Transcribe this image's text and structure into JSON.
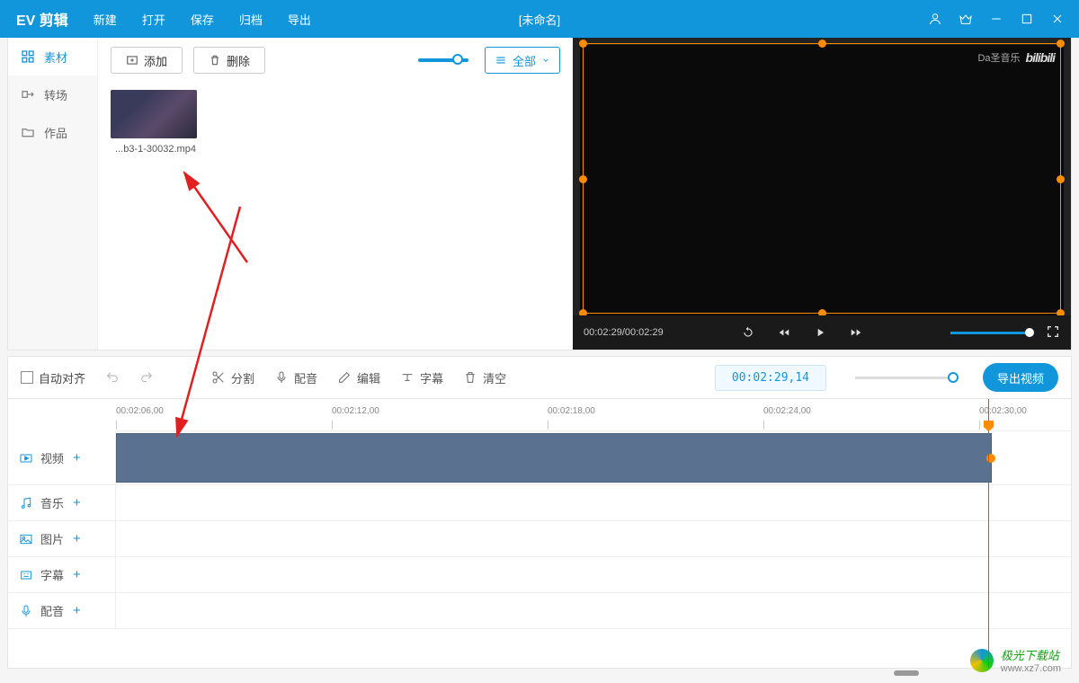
{
  "app": {
    "title": "EV 剪辑",
    "doc_title": "[未命名]"
  },
  "menu": {
    "new": "新建",
    "open": "打开",
    "save": "保存",
    "archive": "归档",
    "export": "导出"
  },
  "sidebar": {
    "items": [
      {
        "label": "素材"
      },
      {
        "label": "转场"
      },
      {
        "label": "作品"
      }
    ]
  },
  "media": {
    "add_btn": "添加",
    "delete_btn": "删除",
    "filter_label": "全部",
    "items": [
      {
        "filename": "...b3-1-30032.mp4"
      }
    ]
  },
  "preview": {
    "time_current": "00:02:29",
    "time_total": "00:02:29",
    "watermark_text": "Da圣音乐",
    "watermark_brand": "bilibili"
  },
  "toolbar": {
    "auto_align": "自动对齐",
    "split": "分割",
    "dub": "配音",
    "edit": "编辑",
    "subtitle": "字幕",
    "clear": "清空",
    "timecode": "00:02:29,14",
    "export_btn": "导出视频"
  },
  "timeline": {
    "ticks": [
      "00:02:06,00",
      "00:02:12,00",
      "00:02:18,00",
      "00:02:24,00",
      "00:02:30,00"
    ],
    "tracks": {
      "video": "视频",
      "music": "音乐",
      "image": "图片",
      "subtitle": "字幕",
      "dub": "配音"
    }
  },
  "footer": {
    "brand": "极光下载站",
    "url": "www.xz7.com"
  }
}
